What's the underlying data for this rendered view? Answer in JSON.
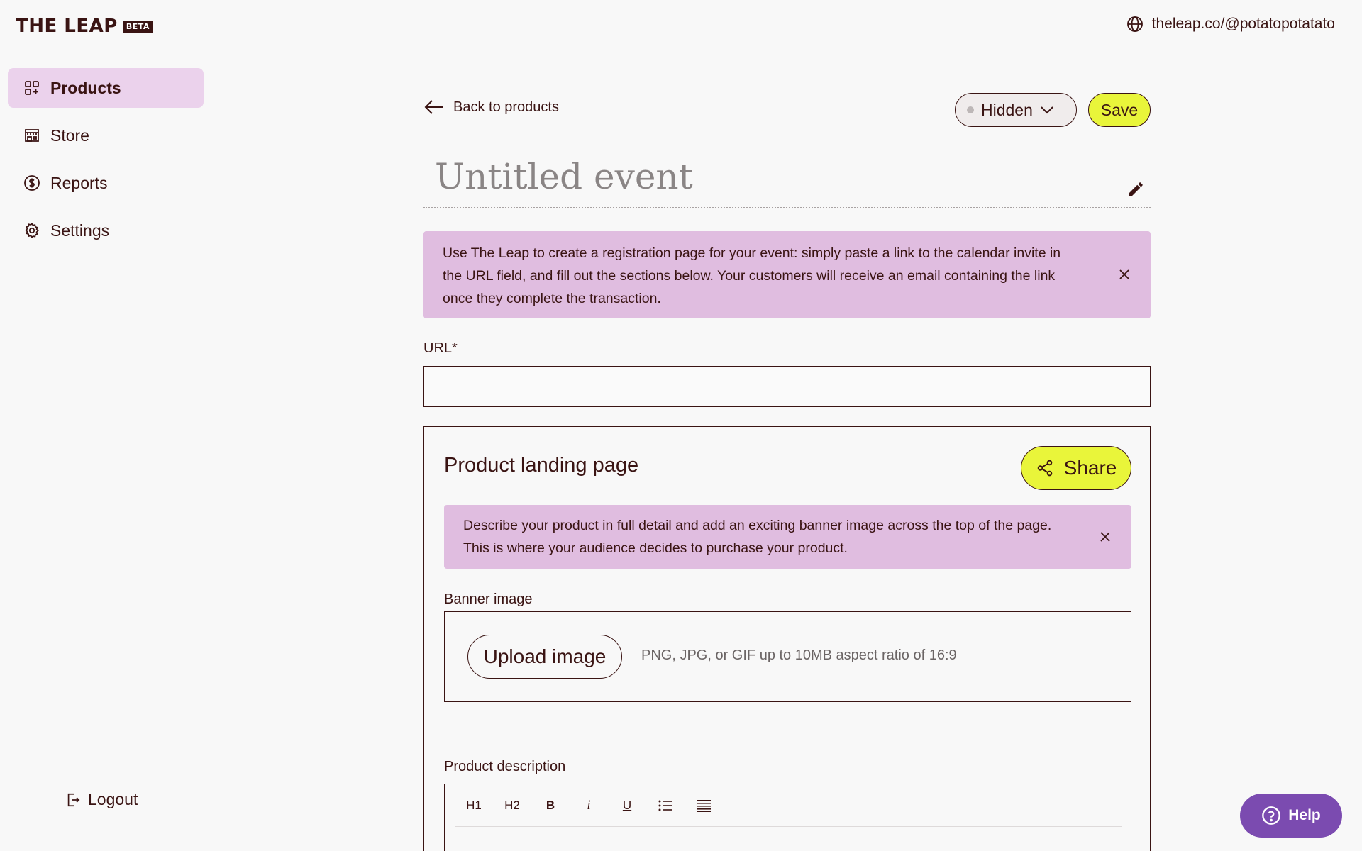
{
  "app": {
    "logo_text": "THE LEAP",
    "logo_badge": "BETA",
    "store_url": "theleap.co/@potatopotatato"
  },
  "sidebar": {
    "items": [
      {
        "label": "Products",
        "icon": "grid-plus-icon",
        "active": true
      },
      {
        "label": "Store",
        "icon": "storefront-icon",
        "active": false
      },
      {
        "label": "Reports",
        "icon": "dollar-circle-icon",
        "active": false
      },
      {
        "label": "Settings",
        "icon": "gear-icon",
        "active": false
      }
    ],
    "logout_label": "Logout"
  },
  "header": {
    "back_label": "Back to products",
    "visibility": "Hidden",
    "save_label": "Save"
  },
  "event": {
    "title_placeholder": "Untitled event"
  },
  "notice_event": {
    "text": "Use The Leap to create a registration page for your event: simply paste a link to the calendar invite in the URL field, and fill out the sections below. Your customers will receive an email containing the link once they complete the transaction."
  },
  "url_field": {
    "label": "URL*",
    "value": ""
  },
  "landing": {
    "title": "Product landing page",
    "share_label": "Share",
    "notice": "Describe your product in full detail and add an exciting banner image across the top of the page. This is where your audience decides to purchase your product.",
    "banner_label": "Banner image",
    "upload_label": "Upload image",
    "upload_hint": "PNG, JPG, or GIF up to 10MB aspect ratio of 16:9",
    "description_label": "Product description",
    "toolbar": [
      "H1",
      "H2",
      "B",
      "i",
      "U"
    ]
  },
  "help": {
    "label": "Help"
  },
  "colors": {
    "accent_yellow": "#e9f53a",
    "active_nav": "#ebd2ec",
    "notice_bg": "#e0bde0",
    "help_purple": "#7b4bb0",
    "text": "#3a1413"
  }
}
